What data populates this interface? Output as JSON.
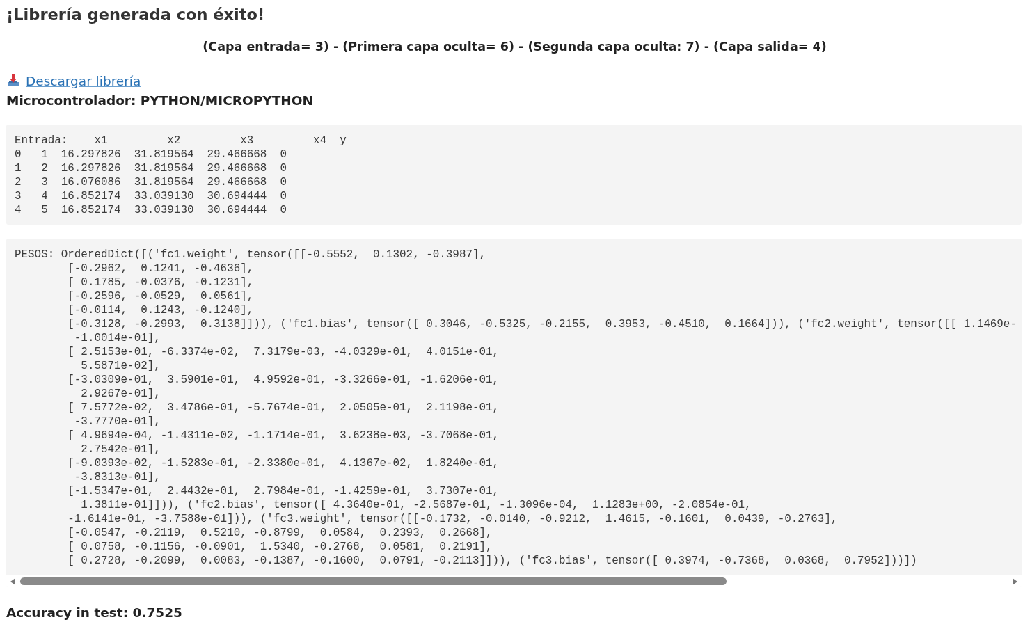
{
  "title": "¡Librería generada con éxito!",
  "summary": "(Capa entrada= 3) - (Primera capa oculta= 6) - (Segunda capa oculta: 7) - (Capa salida= 4)",
  "download_link": "Descargar librería",
  "microcontroller": "Microcontrolador: PYTHON/MICROPYTHON",
  "input_block": {
    "lines": [
      "Entrada:    x1         x2         x3         x4  y",
      "0   1  16.297826  31.819564  29.466668  0",
      "1   2  16.297826  31.819564  29.466668  0",
      "2   3  16.076086  31.819564  29.466668  0",
      "3   4  16.852174  33.039130  30.694444  0",
      "4   5  16.852174  33.039130  30.694444  0"
    ]
  },
  "weights_block": {
    "lines": [
      "PESOS: OrderedDict([('fc1.weight', tensor([[-0.5552,  0.1302, -0.3987],",
      "        [-0.2962,  0.1241, -0.4636],",
      "        [ 0.1785, -0.0376, -0.1231],",
      "        [-0.2596, -0.0529,  0.0561],",
      "        [-0.0114,  0.1243, -0.1240],",
      "        [-0.3128, -0.2993,  0.3138]])), ('fc1.bias', tensor([ 0.3046, -0.5325, -0.2155,  0.3953, -0.4510,  0.1664])), ('fc2.weight', tensor([[ 1.1469e-",
      "         -1.0014e-01],",
      "        [ 2.5153e-01, -6.3374e-02,  7.3179e-03, -4.0329e-01,  4.0151e-01,",
      "          5.5871e-02],",
      "        [-3.0309e-01,  3.5901e-01,  4.9592e-01, -3.3266e-01, -1.6206e-01,",
      "          2.9267e-01],",
      "        [ 7.5772e-02,  3.4786e-01, -5.7674e-01,  2.0505e-01,  2.1198e-01,",
      "         -3.7770e-01],",
      "        [ 4.9694e-04, -1.4311e-02, -1.1714e-01,  3.6238e-03, -3.7068e-01,",
      "          2.7542e-01],",
      "        [-9.0393e-02, -1.5283e-01, -2.3380e-01,  4.1367e-02,  1.8240e-01,",
      "         -3.8313e-01],",
      "        [-1.5347e-01,  2.4432e-01,  2.7984e-01, -1.4259e-01,  3.7307e-01,",
      "          1.3811e-01]])), ('fc2.bias', tensor([ 4.3640e-01, -2.5687e-01, -1.3096e-04,  1.1283e+00, -2.0854e-01,",
      "        -1.6141e-01, -3.7588e-01])), ('fc3.weight', tensor([[-0.1732, -0.0140, -0.9212,  1.4615, -0.1601,  0.0439, -0.2763],",
      "        [-0.0547, -0.2119,  0.5210, -0.8799,  0.0584,  0.2393,  0.2668],",
      "        [ 0.0758, -0.1156, -0.0901,  1.5340, -0.2768,  0.0581,  0.2191],",
      "        [ 0.2728, -0.2099,  0.0083, -0.1387, -0.1600,  0.0791, -0.2113]])), ('fc3.bias', tensor([ 0.3974, -0.7368,  0.0368,  0.7952]))])"
    ]
  },
  "accuracy": "Accuracy in test: 0.7525"
}
